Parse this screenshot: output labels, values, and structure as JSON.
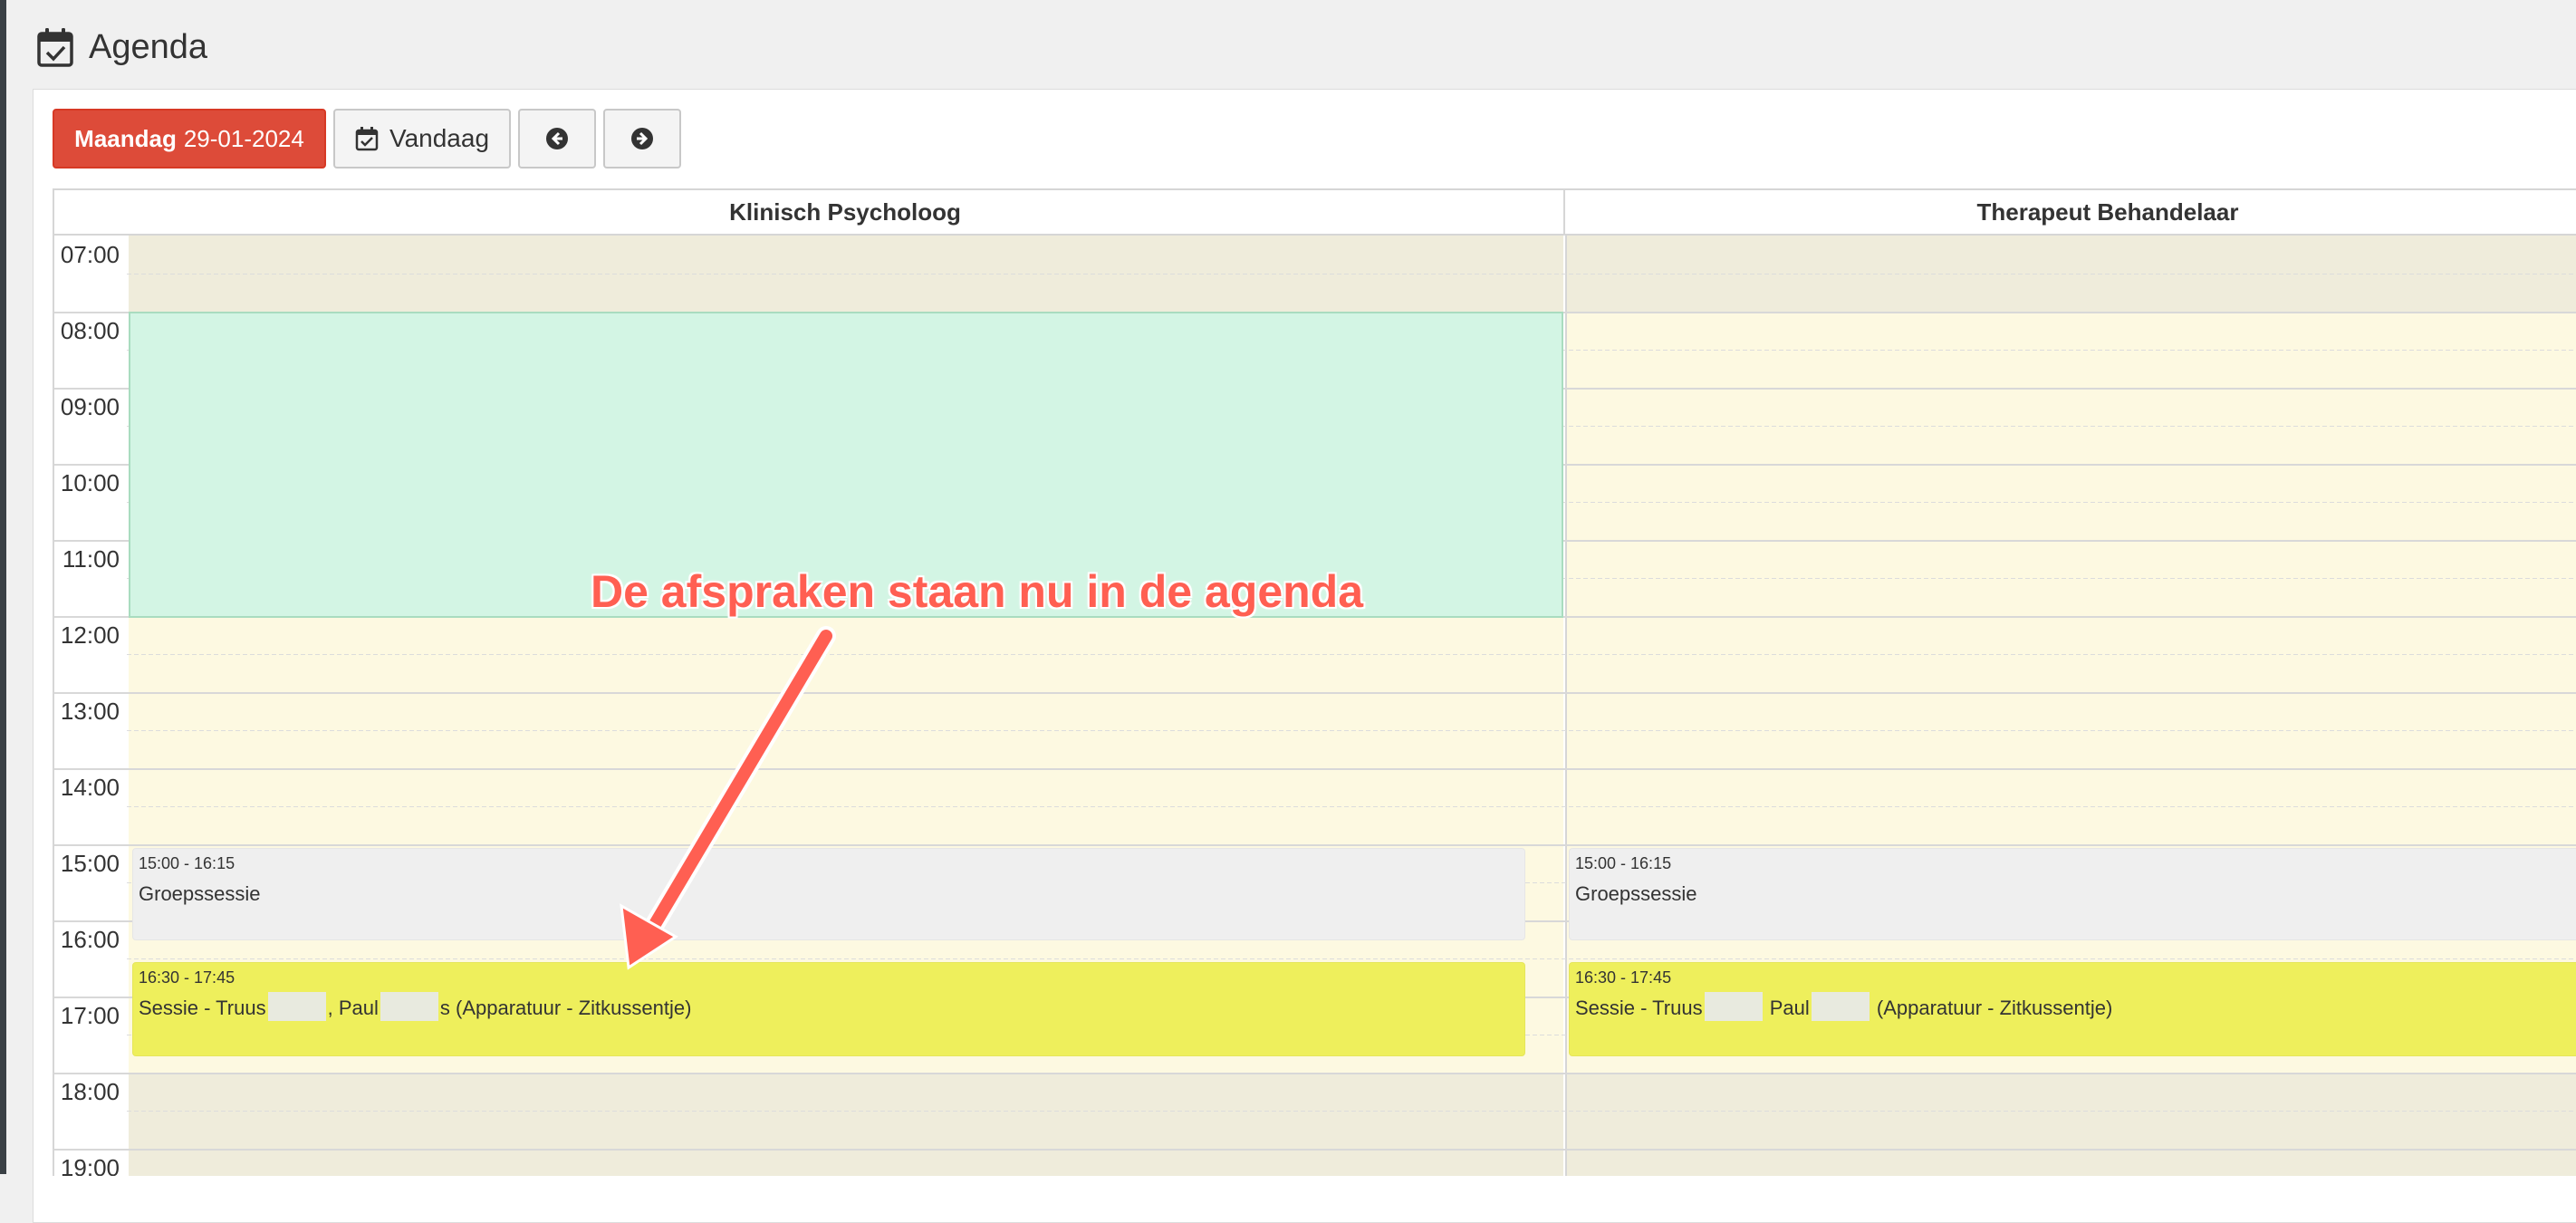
{
  "header": {
    "title": "Agenda",
    "icon": "calendar-check-icon"
  },
  "toolbar": {
    "date_day": "Maandag",
    "date_value": "29-01-2024",
    "today_label": "Vandaag",
    "prev_icon": "arrow-left-circle-icon",
    "next_icon": "arrow-right-circle-icon"
  },
  "columns": [
    "Klinisch Psycholoog",
    "Therapeut Behandelaar"
  ],
  "times": [
    "07:00",
    "08:00",
    "09:00",
    "10:00",
    "11:00",
    "12:00",
    "13:00",
    "14:00",
    "15:00",
    "16:00",
    "17:00",
    "18:00",
    "19:00"
  ],
  "events": {
    "group": {
      "time": "15:00 - 16:15",
      "title": "Groepssessie"
    },
    "session": {
      "time": "16:30 - 17:45",
      "prefix": "Sessie - Truus",
      "sep1": ", Paul",
      "sep1b": " Paul",
      "suffix": " (Apparatuur - Zitkussentje)",
      "suffix1": "s (Apparatuur - Zitkussentje)"
    }
  },
  "annotation": "De afspraken staan nu in de agenda",
  "colors": {
    "primary_button": "#dd4b39",
    "available": "#d3f5e4",
    "session": "#eeef5c",
    "annotation": "#ff5f52"
  }
}
